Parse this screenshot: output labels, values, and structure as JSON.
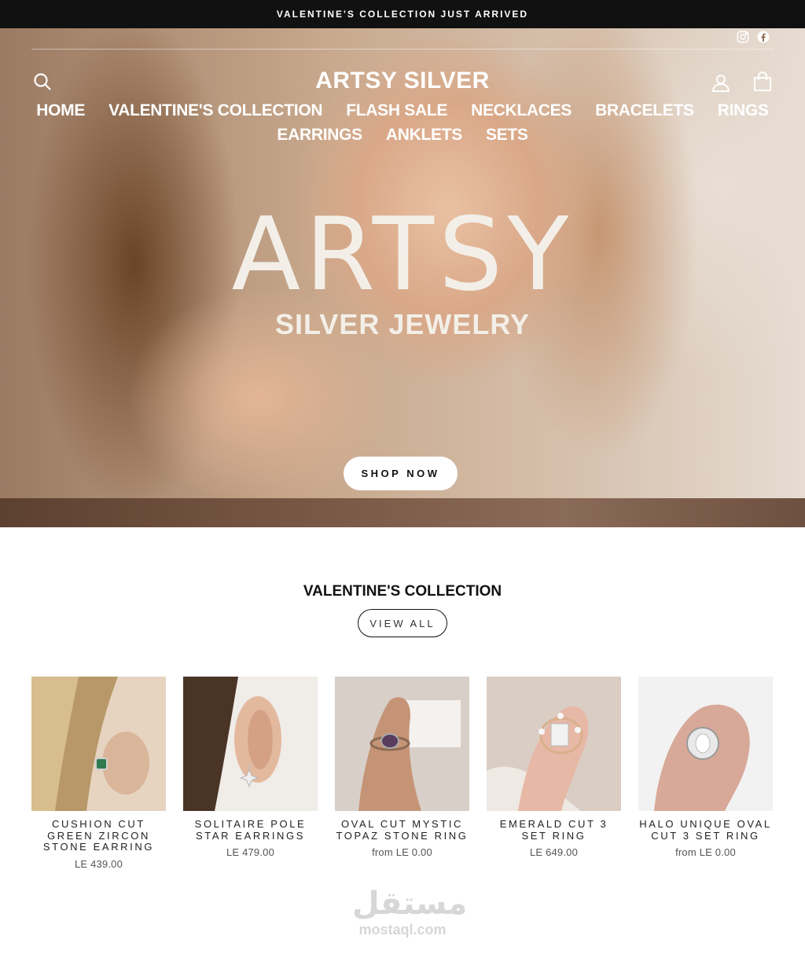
{
  "announcement": "VALENTINE'S COLLECTION JUST ARRIVED",
  "header": {
    "logo": "ARTSY SILVER",
    "social": [
      "instagram-icon",
      "facebook-icon"
    ]
  },
  "nav": {
    "items": [
      "HOME",
      "VALENTINE'S COLLECTION",
      "FLASH SALE",
      "NECKLACES",
      "BRACELETS",
      "RINGS",
      "EARRINGS",
      "ANKLETS",
      "SETS"
    ]
  },
  "hero": {
    "title": "ARTSY",
    "subtitle": "SILVER JEWELRY",
    "cta": "SHOP NOW"
  },
  "collection": {
    "title": "VALENTINE'S COLLECTION",
    "view_all": "VIEW ALL",
    "products": [
      {
        "name": "CUSHION CUT GREEN ZIRCON STONE EARRING",
        "price": "LE 439.00"
      },
      {
        "name": "SOLITAIRE POLE STAR EARRINGS",
        "price": "LE 479.00"
      },
      {
        "name": "OVAL CUT MYSTIC TOPAZ STONE RING",
        "price": "from LE 0.00"
      },
      {
        "name": "EMERALD CUT 3 SET RING",
        "price": "LE 649.00"
      },
      {
        "name": "HALO UNIQUE OVAL CUT 3 SET RING",
        "price": "from LE 0.00"
      }
    ]
  },
  "watermark": {
    "arabic": "مستقل",
    "latin": "mostaql.com"
  },
  "colors": {
    "announcement_bg": "#111111",
    "text": "#111111",
    "hero_text": "#f3efe8"
  }
}
